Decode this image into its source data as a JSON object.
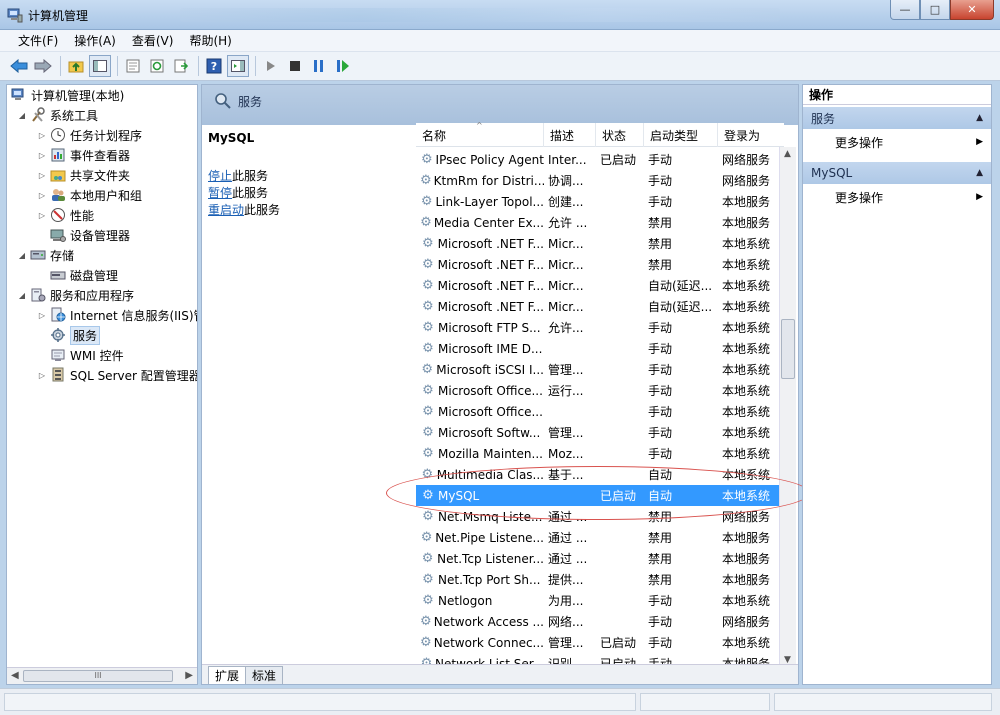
{
  "window": {
    "title": "计算机管理",
    "min": "—",
    "max": "□",
    "close": "✕"
  },
  "menu": [
    "文件(F)",
    "操作(A)",
    "查看(V)",
    "帮助(H)"
  ],
  "tree": {
    "root": "计算机管理(本地)",
    "system_tools": "系统工具",
    "task_scheduler": "任务计划程序",
    "event_viewer": "事件查看器",
    "shared_folders": "共享文件夹",
    "local_users": "本地用户和组",
    "performance": "性能",
    "device_manager": "设备管理器",
    "storage": "存储",
    "disk_mgmt": "磁盘管理",
    "services_apps": "服务和应用程序",
    "iis": "Internet 信息服务(IIS)管",
    "services": "服务",
    "wmi": "WMI 控件",
    "sql_server": "SQL Server 配置管理器"
  },
  "center": {
    "header_title": "服务",
    "detail": {
      "title": "MySQL",
      "stop_link": "停止",
      "stop_rest": "此服务",
      "pause_link": "暂停",
      "pause_rest": "此服务",
      "restart_link": "重启动",
      "restart_rest": "此服务"
    },
    "columns": [
      "名称",
      "描述",
      "状态",
      "启动类型",
      "登录为"
    ],
    "rows": [
      [
        "IPsec Policy Agent",
        "Inter...",
        "已启动",
        "手动",
        "网络服务"
      ],
      [
        "KtmRm for Distri...",
        "协调...",
        "",
        "手动",
        "网络服务"
      ],
      [
        "Link-Layer Topol...",
        "创建...",
        "",
        "手动",
        "本地服务"
      ],
      [
        "Media Center Ex...",
        "允许 ...",
        "",
        "禁用",
        "本地服务"
      ],
      [
        "Microsoft .NET F...",
        "Micr...",
        "",
        "禁用",
        "本地系统"
      ],
      [
        "Microsoft .NET F...",
        "Micr...",
        "",
        "禁用",
        "本地系统"
      ],
      [
        "Microsoft .NET F...",
        "Micr...",
        "",
        "自动(延迟...",
        "本地系统"
      ],
      [
        "Microsoft .NET F...",
        "Micr...",
        "",
        "自动(延迟...",
        "本地系统"
      ],
      [
        "Microsoft FTP S...",
        "允许...",
        "",
        "手动",
        "本地系统"
      ],
      [
        "Microsoft IME D...",
        "",
        "",
        "手动",
        "本地系统"
      ],
      [
        "Microsoft iSCSI I...",
        "管理...",
        "",
        "手动",
        "本地系统"
      ],
      [
        "Microsoft Office...",
        "运行...",
        "",
        "手动",
        "本地系统"
      ],
      [
        "Microsoft Office...",
        "",
        "",
        "手动",
        "本地系统"
      ],
      [
        "Microsoft Softw...",
        "管理...",
        "",
        "手动",
        "本地系统"
      ],
      [
        "Mozilla Mainten...",
        "Moz...",
        "",
        "手动",
        "本地系统"
      ],
      [
        "Multimedia Clas...",
        "基于...",
        "",
        "自动",
        "本地系统"
      ],
      [
        "MySQL",
        "",
        "已启动",
        "自动",
        "本地系统"
      ],
      [
        "Net.Msmq Liste...",
        "通过 ...",
        "",
        "禁用",
        "网络服务"
      ],
      [
        "Net.Pipe Listene...",
        "通过 ...",
        "",
        "禁用",
        "本地服务"
      ],
      [
        "Net.Tcp Listener...",
        "通过 ...",
        "",
        "禁用",
        "本地服务"
      ],
      [
        "Net.Tcp Port Sh...",
        "提供...",
        "",
        "禁用",
        "本地服务"
      ],
      [
        "Netlogon",
        "为用...",
        "",
        "手动",
        "本地系统"
      ],
      [
        "Network Access ...",
        "网络...",
        "",
        "手动",
        "网络服务"
      ],
      [
        "Network Connec...",
        "管理...",
        "已启动",
        "手动",
        "本地系统"
      ],
      [
        "Network List Ser...",
        "识别...",
        "已启动",
        "手动",
        "本地服务"
      ]
    ],
    "selected_row": 16,
    "tabs": [
      "扩展",
      "标准"
    ]
  },
  "actions": {
    "header": "操作",
    "section1": "服务",
    "more1": "更多操作",
    "section2": "MySQL",
    "more2": "更多操作"
  },
  "colors": {
    "selection": "#3399ff",
    "annotation": "#d9534f",
    "link": "#1a5fb4"
  }
}
